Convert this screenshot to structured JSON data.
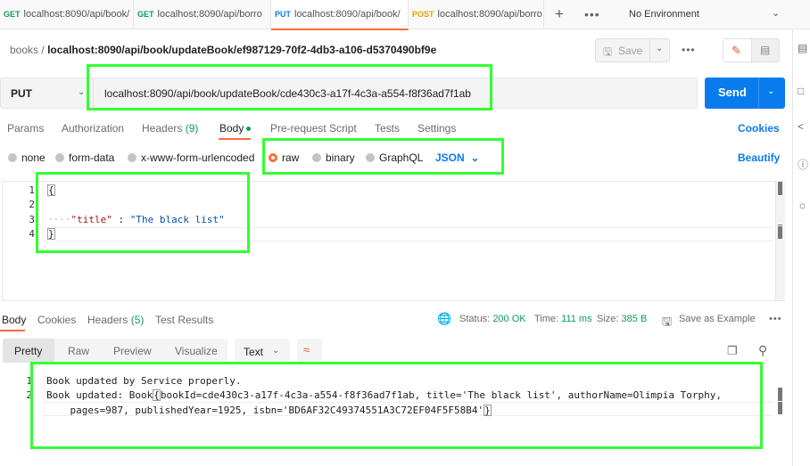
{
  "tabs": [
    {
      "method": "GET",
      "label": "localhost:8090/api/book/"
    },
    {
      "method": "GET",
      "label": "localhost:8090/api/borro"
    },
    {
      "method": "PUT",
      "label": "localhost:8090/api/book/"
    },
    {
      "method": "POST",
      "label": "localhost:8090/api/borro"
    }
  ],
  "tab_add": "+",
  "tab_more": "•••",
  "environment": "No Environment",
  "breadcrumb": {
    "collection": "books",
    "separator": "/",
    "name": "localhost:8090/api/book/updateBook/ef987129-70f2-4db3-a106-d5370490bf9e"
  },
  "save_label": "Save",
  "request": {
    "method": "PUT",
    "url": "localhost:8090/api/book/updateBook/cde430c3-a17f-4c3a-a554-f8f36ad7f1ab",
    "send_label": "Send"
  },
  "request_tabs": [
    {
      "label": "Params",
      "count": ""
    },
    {
      "label": "Authorization",
      "count": ""
    },
    {
      "label": "Headers",
      "count": "(9)"
    },
    {
      "label": "Body",
      "count": ""
    },
    {
      "label": "Pre-request Script",
      "count": ""
    },
    {
      "label": "Tests",
      "count": ""
    },
    {
      "label": "Settings",
      "count": ""
    }
  ],
  "cookies_label": "Cookies",
  "beautify_label": "Beautify",
  "body_types": [
    "none",
    "form-data",
    "x-www-form-urlencoded",
    "raw",
    "binary",
    "GraphQL"
  ],
  "body_format": "JSON",
  "editor": {
    "line_numbers": [
      "1",
      "2",
      "3",
      "4"
    ],
    "line1": "{",
    "line3_indent": "····",
    "line3_key": "\"title\"",
    "line3_colon": " : ",
    "line3_value": "\"The black list\"",
    "line4": "}"
  },
  "response_tabs": [
    {
      "label": "Body",
      "count": ""
    },
    {
      "label": "Cookies",
      "count": ""
    },
    {
      "label": "Headers",
      "count": "(5)"
    },
    {
      "label": "Test Results",
      "count": ""
    }
  ],
  "response_status": {
    "status_label": "Status:",
    "status_value": "200 OK",
    "time_label": "Time:",
    "time_value": "111 ms",
    "size_label": "Size:",
    "size_value": "385 B",
    "save_example": "Save as Example"
  },
  "view_modes": [
    "Pretty",
    "Raw",
    "Preview",
    "Visualize"
  ],
  "response_format": "Text",
  "response": {
    "line_numbers": [
      "1",
      "2"
    ],
    "line1": "Book updated by Service properly.",
    "line2a_pre": "Book updated: Book",
    "line2a_brace": "{",
    "line2a_post": "bookId=cde430c3-a17f-4c3a-a554-f8f36ad7f1ab, title='The black list', authorName=Olimpia Torphy,",
    "line2b_pre": "    pages=987, publishedYear=1925, isbn='BD6AF32C49374551A3C72EF04F5F58B4'",
    "line2b_brace": "}"
  },
  "colors": {
    "accent": "#ff6c37",
    "primary": "#097bed",
    "success": "#0f9d58",
    "annotation": "#33ff33"
  }
}
